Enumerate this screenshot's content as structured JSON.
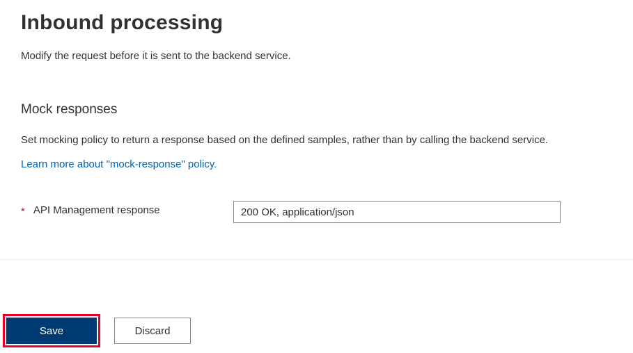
{
  "header": {
    "title": "Inbound processing",
    "description": "Modify the request before it is sent to the backend service."
  },
  "section": {
    "title": "Mock responses",
    "description": "Set mocking policy to return a response based on the defined samples, rather than by calling the backend service.",
    "learn_more": "Learn more about \"mock-response\" policy."
  },
  "form": {
    "response_label": "API Management response",
    "response_value": "200 OK, application/json"
  },
  "footer": {
    "save_label": "Save",
    "discard_label": "Discard"
  }
}
